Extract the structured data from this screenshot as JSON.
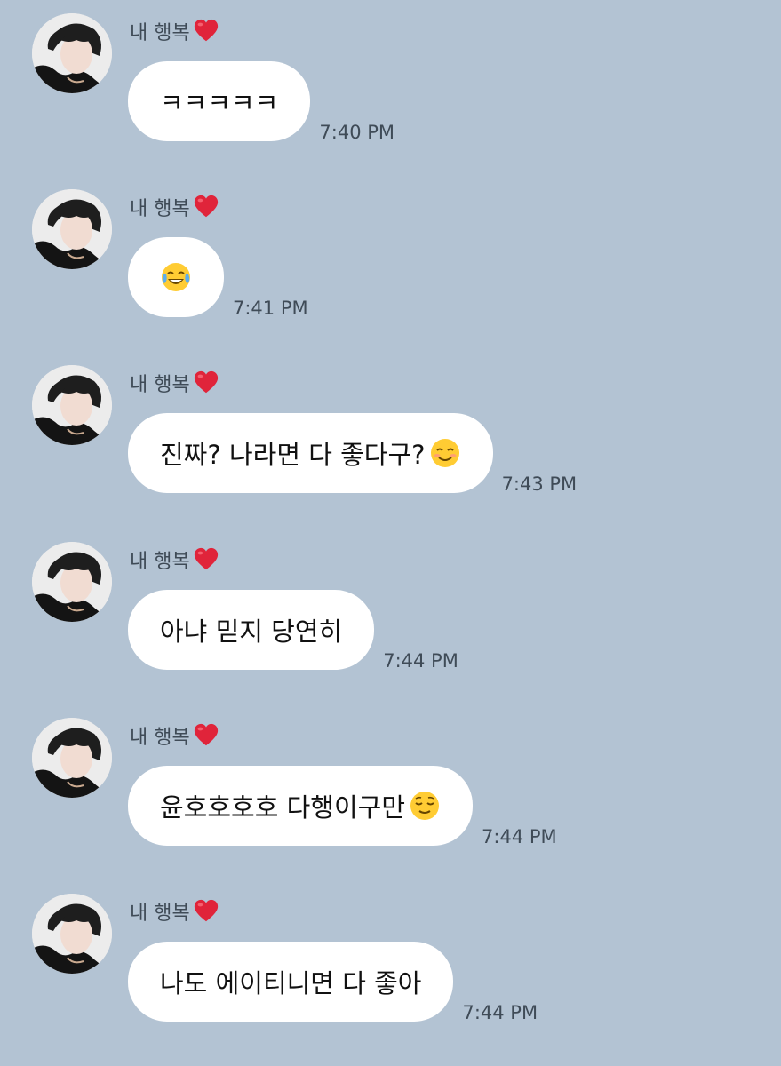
{
  "chat": {
    "messages": [
      {
        "sender": "내 행복",
        "text": "ㅋㅋㅋㅋㅋ",
        "emoji": null,
        "time": "7:40 PM"
      },
      {
        "sender": "내 행복",
        "text": "",
        "emoji": "face-with-tears-of-joy",
        "time": "7:41 PM"
      },
      {
        "sender": "내 행복",
        "text": "진짜? 나라면 다 좋다구?",
        "emoji": "smiling-face",
        "time": "7:43 PM"
      },
      {
        "sender": "내 행복",
        "text": "아냐 믿지 당연히",
        "emoji": null,
        "time": "7:44 PM"
      },
      {
        "sender": "내 행복",
        "text": "윤호호호호 다행이구만",
        "emoji": "relieved-face",
        "time": "7:44 PM"
      },
      {
        "sender": "내 행복",
        "text": "나도 에이티니면 다 좋아",
        "emoji": null,
        "time": "7:44 PM"
      }
    ],
    "sender_badge_icon": "red-heart-icon",
    "avatar_icon": "profile-photo",
    "colors": {
      "background": "#b3c3d3",
      "bubble": "#ffffff",
      "meta_text": "#3f4b57",
      "heart": "#e0243a",
      "emoji_yellow": "#ffcc33"
    }
  }
}
